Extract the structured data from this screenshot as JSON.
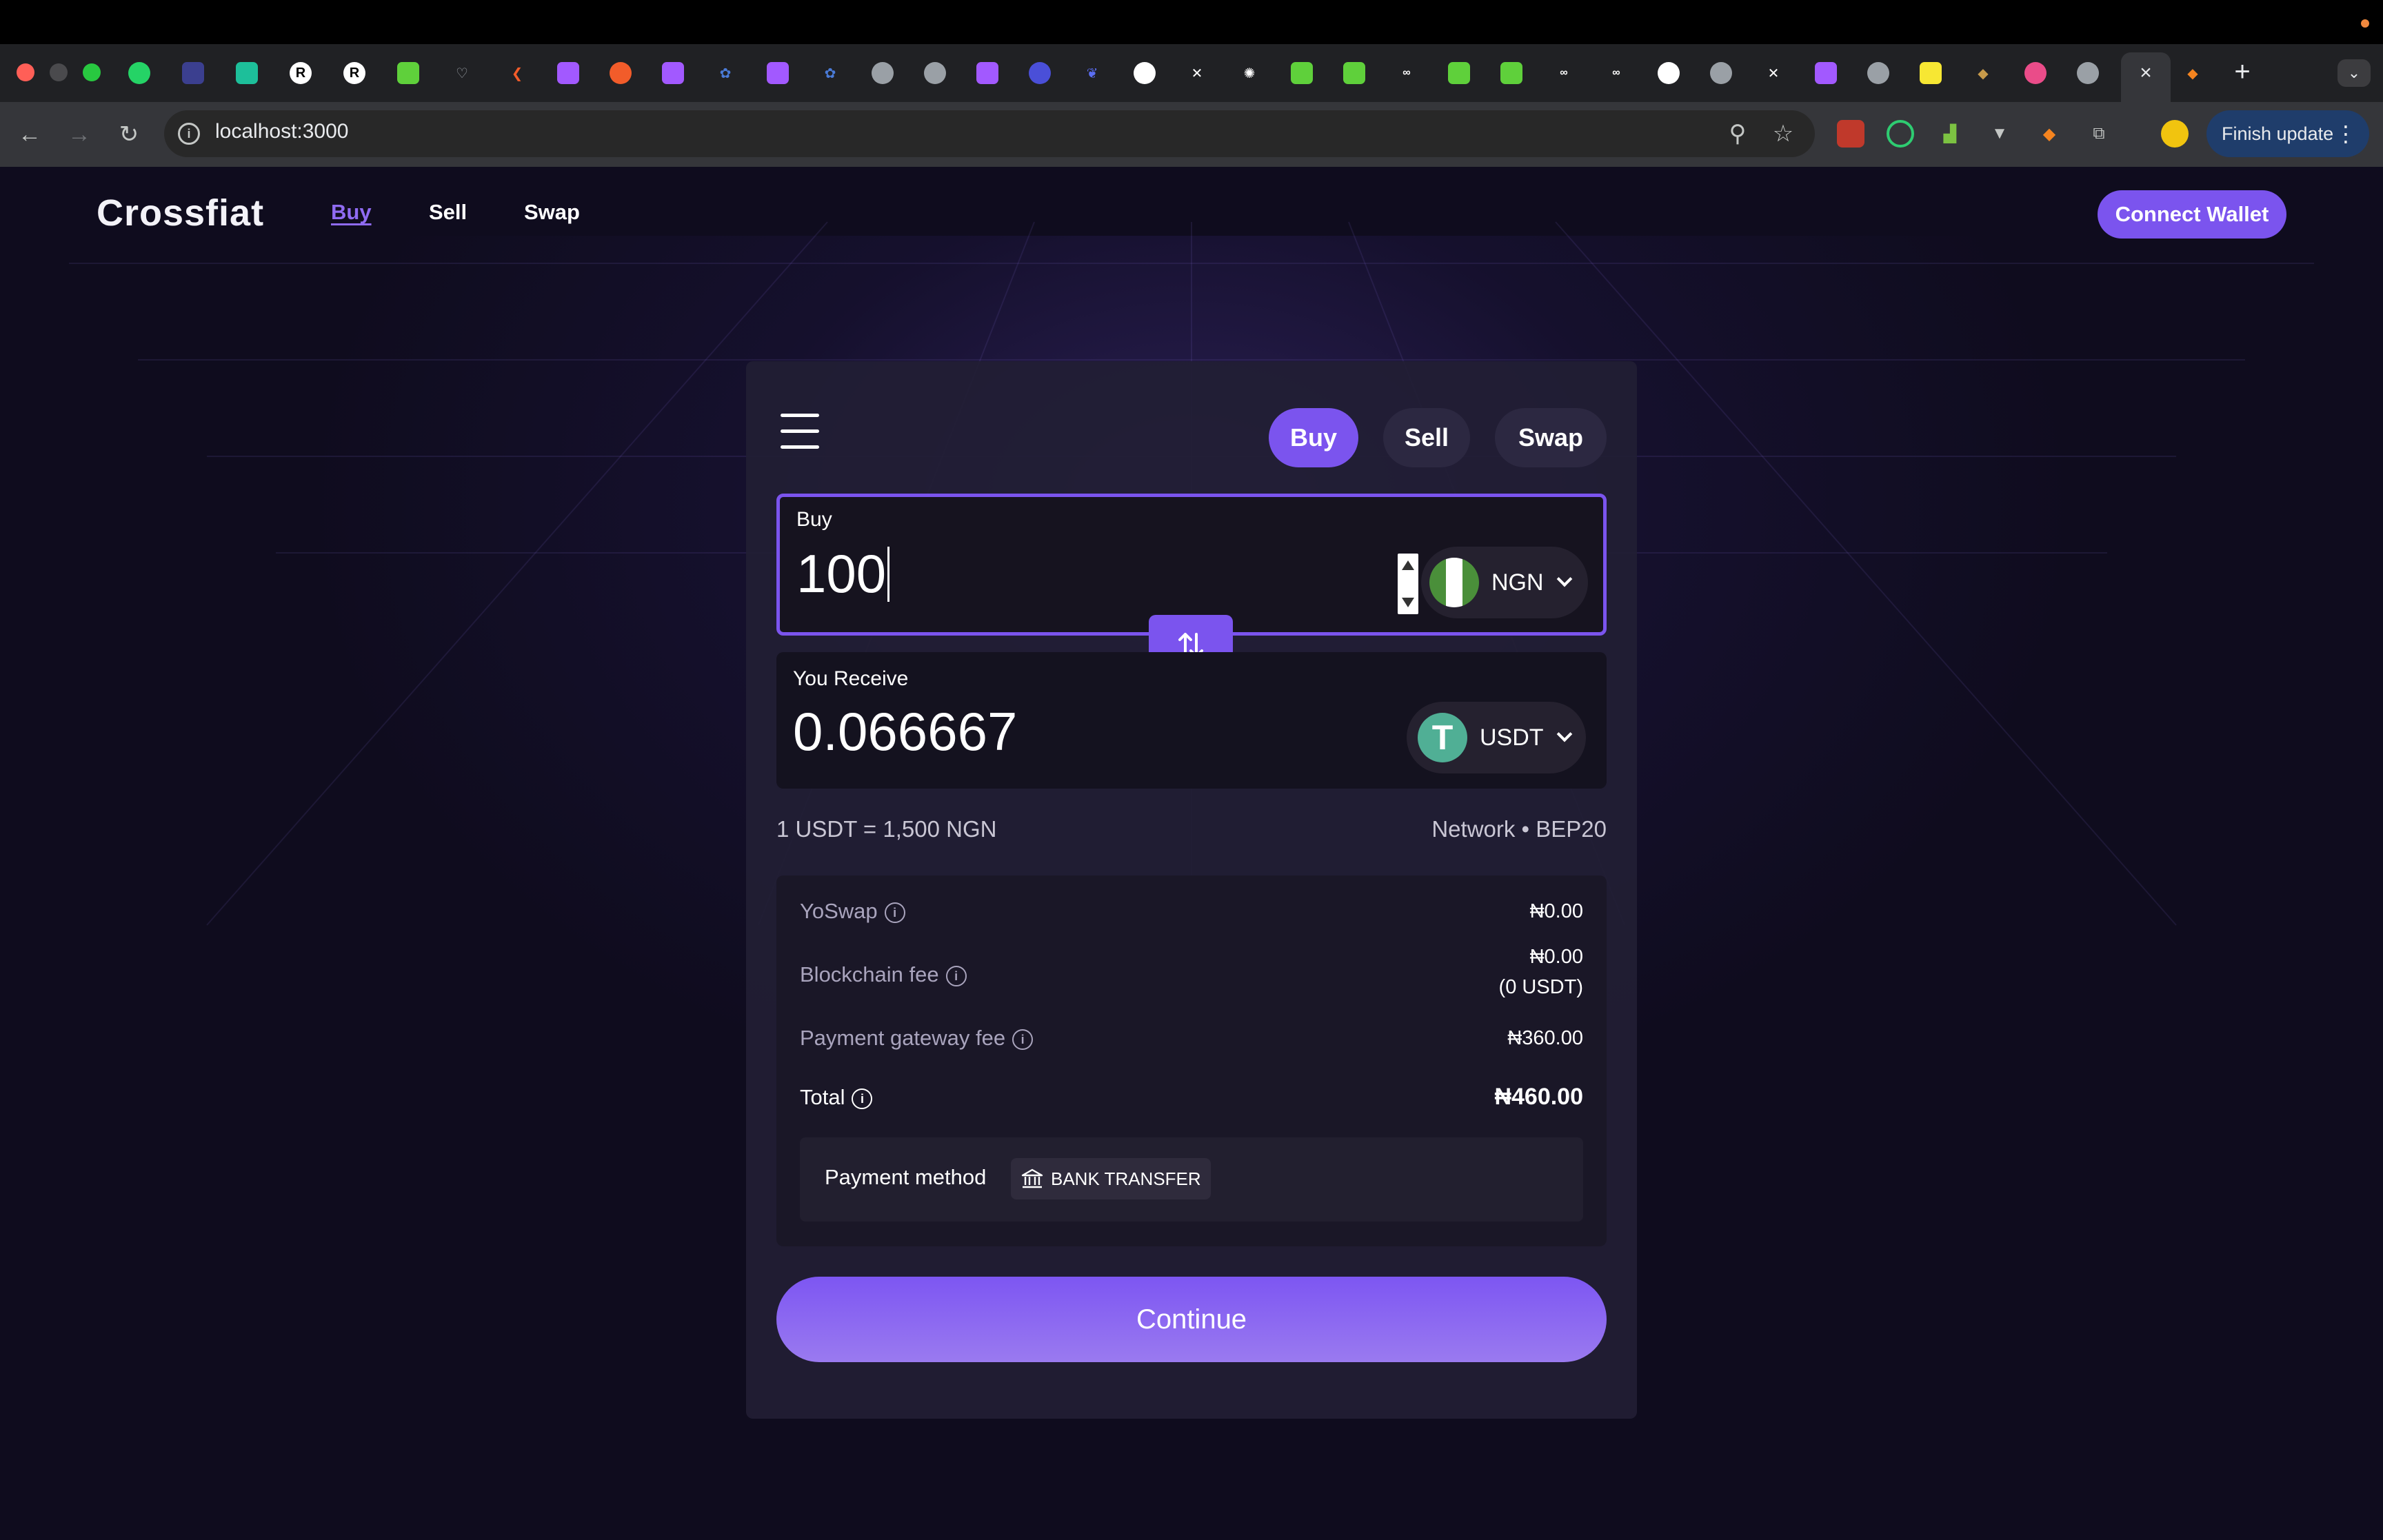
{
  "browser": {
    "url": "localhost:3000",
    "finish_update_label": "Finish update",
    "new_tab_symbol": "+",
    "tab_close_symbol": "×"
  },
  "app": {
    "brand": "Crossfiat",
    "nav": {
      "buy": "Buy",
      "sell": "Sell",
      "swap": "Swap"
    },
    "connect_wallet": "Connect Wallet"
  },
  "widget": {
    "mode_tabs": {
      "buy": "Buy",
      "sell": "Sell",
      "swap": "Swap"
    },
    "buy": {
      "label": "Buy",
      "amount": "100",
      "currency": "NGN"
    },
    "receive": {
      "label": "You Receive",
      "amount": "0.066667",
      "currency": "USDT"
    },
    "rate": "1 USDT = 1,500 NGN",
    "network": "Network • BEP20",
    "fees": {
      "yoswap": {
        "label": "YoSwap",
        "value": "₦0.00"
      },
      "blockchain": {
        "label": "Blockchain fee",
        "value": "₦0.00",
        "subvalue": "(0 USDT)"
      },
      "gateway": {
        "label": "Payment gateway fee",
        "value": "₦360.00"
      },
      "total": {
        "label": "Total",
        "value": "₦460.00"
      }
    },
    "payment_method": {
      "label": "Payment method",
      "value": "BANK TRANSFER"
    },
    "continue_label": "Continue"
  },
  "colors": {
    "accent": "#7b54ee",
    "page_bg": "#0f0c1e",
    "card_bg": "#221e34",
    "nav_active": "#8f6bf2",
    "tether_green": "#50af95"
  }
}
